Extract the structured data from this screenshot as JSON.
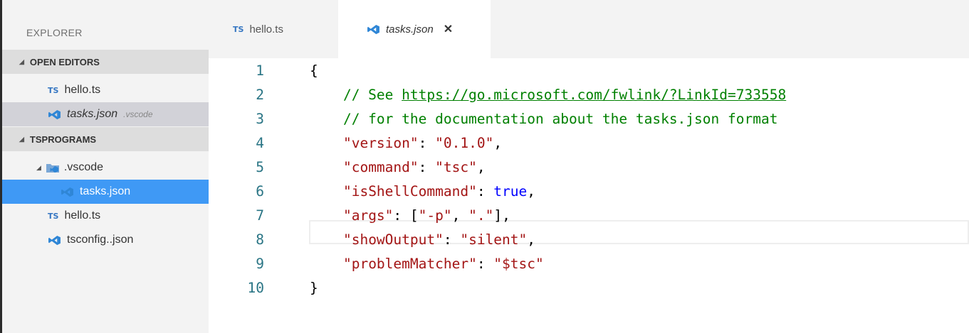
{
  "sidebar": {
    "title": "EXPLORER",
    "open_editors": {
      "label": "OPEN EDITORS",
      "items": [
        {
          "name": "hello.ts",
          "type": "ts"
        },
        {
          "name": "tasks.json",
          "hint": ".vscode",
          "type": "vscode"
        }
      ]
    },
    "workspace": {
      "label": "TSPROGRAMS",
      "folder": ".vscode",
      "folder_children": [
        {
          "name": "tasks.json",
          "type": "vscode"
        }
      ],
      "files": [
        {
          "name": "hello.ts",
          "type": "ts"
        },
        {
          "name": "tsconfig..json",
          "type": "vscode"
        }
      ]
    }
  },
  "tabs": [
    {
      "label": "hello.ts",
      "type": "ts",
      "active": false
    },
    {
      "label": "tasks.json",
      "type": "vscode",
      "active": true,
      "close": "✕"
    }
  ],
  "editor": {
    "current_line": 7,
    "lines": [
      {
        "n": "1",
        "tokens": [
          {
            "t": "{",
            "c": "punc"
          }
        ]
      },
      {
        "n": "2",
        "tokens": [
          {
            "t": "    // See ",
            "c": "comment"
          },
          {
            "t": "https://go.microsoft.com/fwlink/?LinkId=733558",
            "c": "link"
          }
        ]
      },
      {
        "n": "3",
        "tokens": [
          {
            "t": "    // for the documentation about the tasks.json format",
            "c": "comment"
          }
        ]
      },
      {
        "n": "4",
        "tokens": [
          {
            "t": "    ",
            "c": "punc"
          },
          {
            "t": "\"version\"",
            "c": "key"
          },
          {
            "t": ": ",
            "c": "punc"
          },
          {
            "t": "\"0.1.0\"",
            "c": "str"
          },
          {
            "t": ",",
            "c": "punc"
          }
        ]
      },
      {
        "n": "5",
        "tokens": [
          {
            "t": "    ",
            "c": "punc"
          },
          {
            "t": "\"command\"",
            "c": "key"
          },
          {
            "t": ": ",
            "c": "punc"
          },
          {
            "t": "\"tsc\"",
            "c": "str"
          },
          {
            "t": ",",
            "c": "punc"
          }
        ]
      },
      {
        "n": "6",
        "tokens": [
          {
            "t": "    ",
            "c": "punc"
          },
          {
            "t": "\"isShellCommand\"",
            "c": "key"
          },
          {
            "t": ": ",
            "c": "punc"
          },
          {
            "t": "true",
            "c": "bool"
          },
          {
            "t": ",",
            "c": "punc"
          }
        ]
      },
      {
        "n": "7",
        "tokens": [
          {
            "t": "    ",
            "c": "punc"
          },
          {
            "t": "\"args\"",
            "c": "key"
          },
          {
            "t": ": [",
            "c": "punc"
          },
          {
            "t": "\"-p\"",
            "c": "str"
          },
          {
            "t": ", ",
            "c": "punc"
          },
          {
            "t": "\".\"",
            "c": "str"
          },
          {
            "t": "],",
            "c": "punc"
          }
        ]
      },
      {
        "n": "8",
        "tokens": [
          {
            "t": "    ",
            "c": "punc"
          },
          {
            "t": "\"showOutput\"",
            "c": "key"
          },
          {
            "t": ": ",
            "c": "punc"
          },
          {
            "t": "\"silent\"",
            "c": "str"
          },
          {
            "t": ",",
            "c": "punc"
          }
        ]
      },
      {
        "n": "9",
        "tokens": [
          {
            "t": "    ",
            "c": "punc"
          },
          {
            "t": "\"problemMatcher\"",
            "c": "key"
          },
          {
            "t": ": ",
            "c": "punc"
          },
          {
            "t": "\"$tsc\"",
            "c": "str"
          }
        ]
      },
      {
        "n": "10",
        "tokens": [
          {
            "t": "}",
            "c": "punc"
          }
        ]
      }
    ]
  },
  "colors": {
    "selected_bg": "#3f99f5",
    "ts_icon": "#3576c2",
    "vscode_icon": "#2f86d6",
    "comment": "#008000",
    "string": "#a31515",
    "keyword": "#0000ff",
    "line_number": "#2a7585"
  },
  "icons": {
    "ts": "ts-file-icon",
    "vscode": "vscode-json-icon",
    "folder": "vscode-folder-icon",
    "close": "close-icon",
    "expand": "expanded-triangle-icon"
  }
}
